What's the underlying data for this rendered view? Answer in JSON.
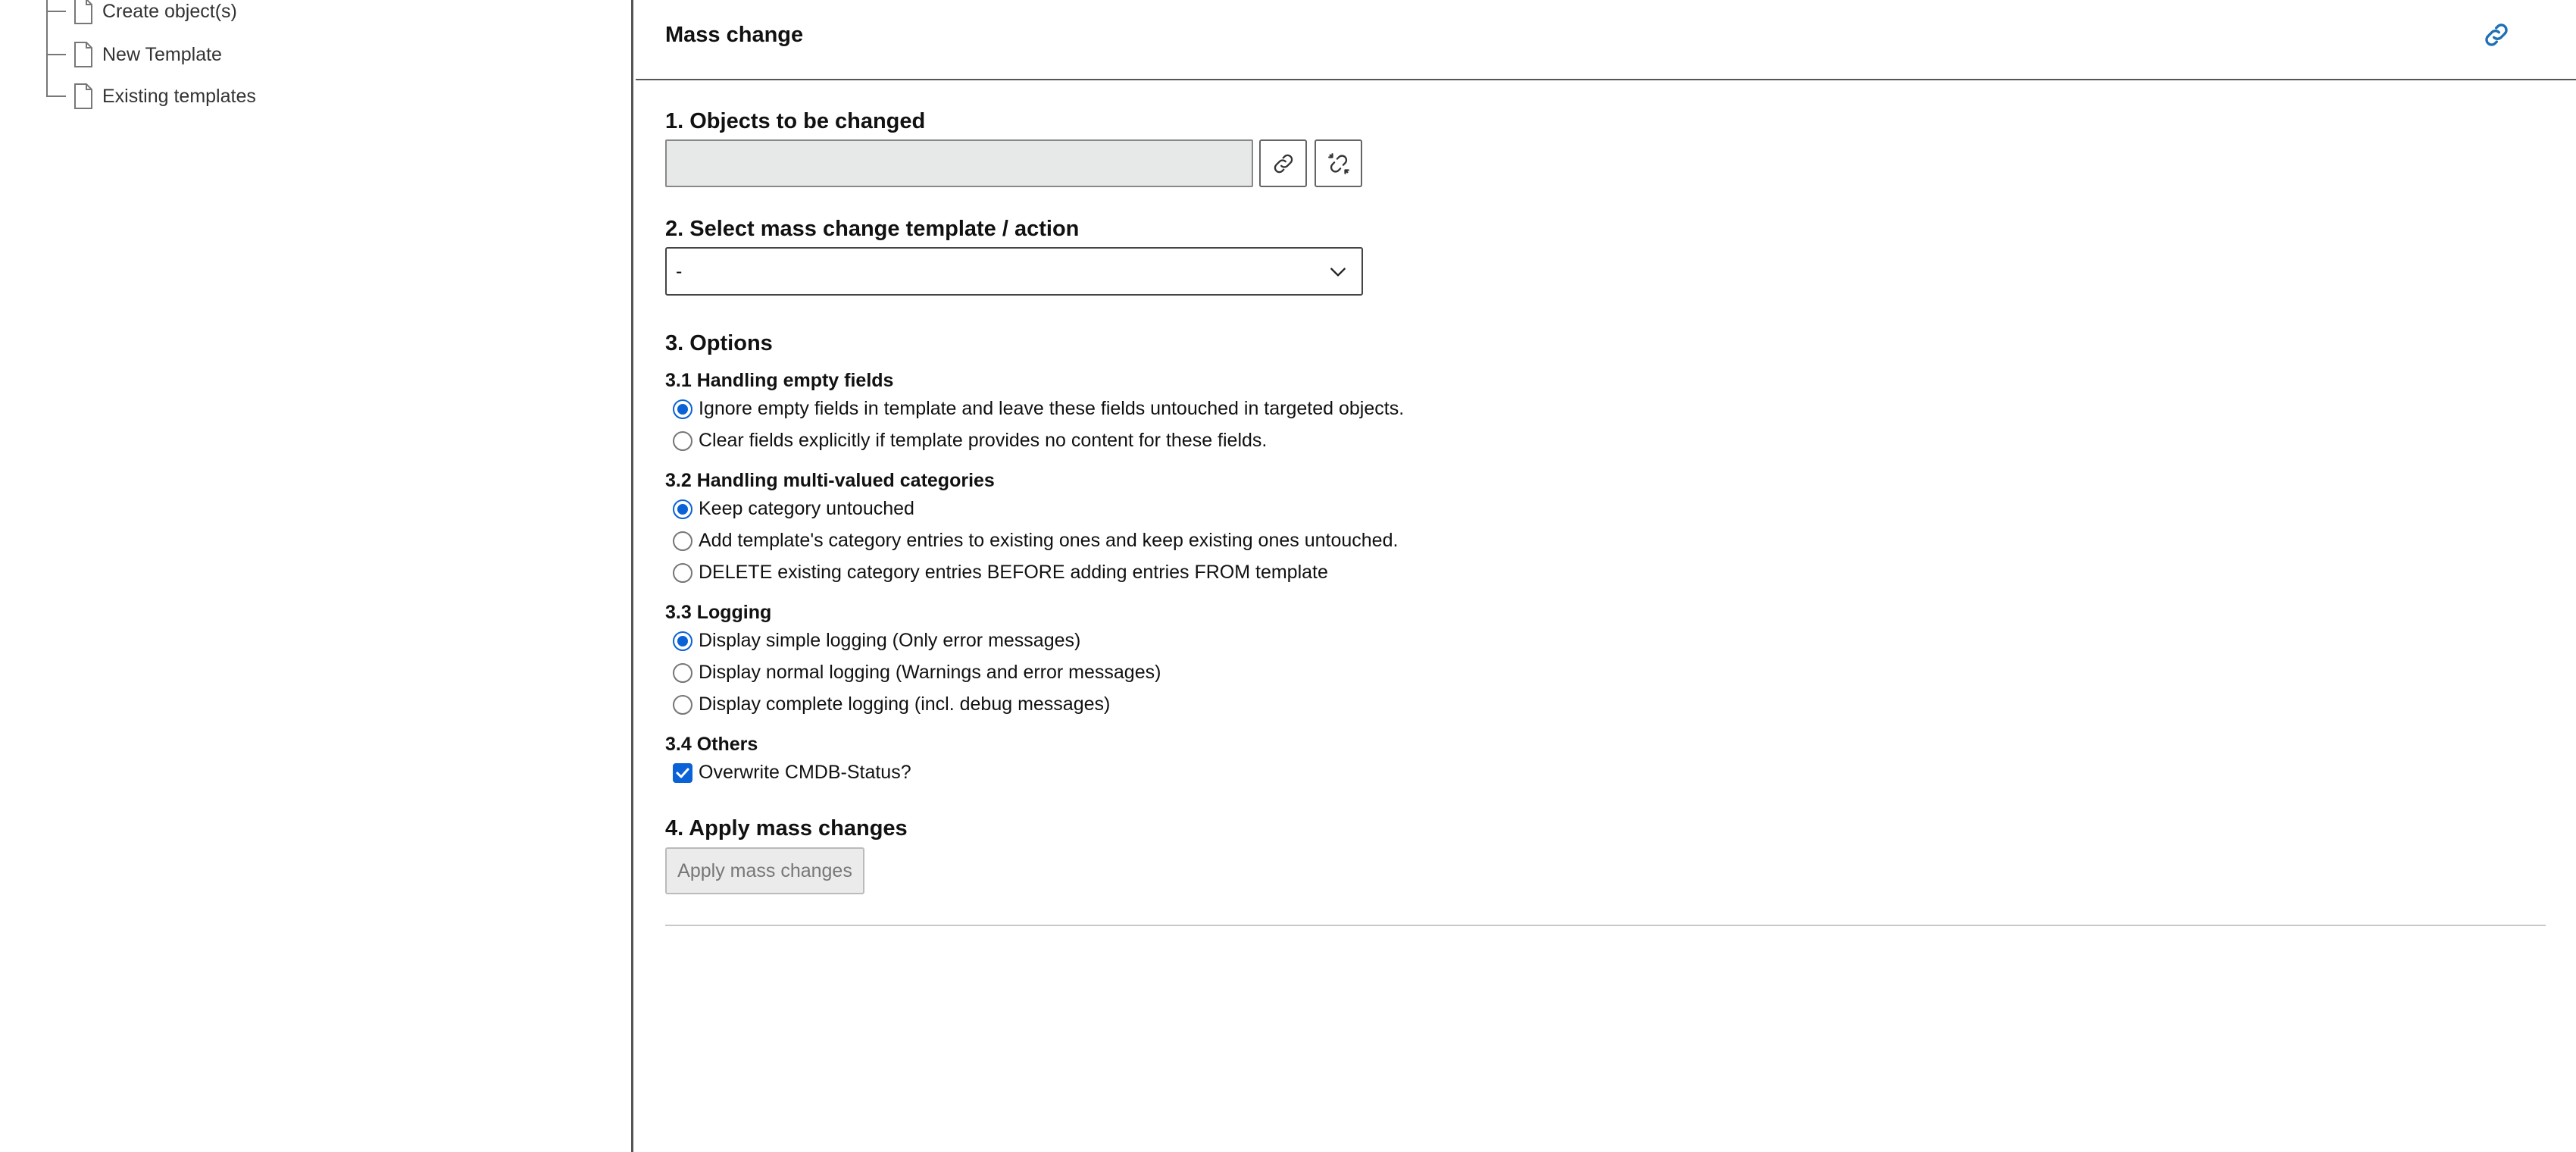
{
  "sidebar": {
    "items": [
      {
        "label": "Create object(s)",
        "icon": "file-icon"
      },
      {
        "label": "New Template",
        "icon": "file-icon"
      },
      {
        "label": "Existing templates",
        "icon": "file-icon"
      }
    ]
  },
  "header": {
    "title": "Mass change",
    "link_icon": "link-icon"
  },
  "section1": {
    "title": "1. Objects to be changed",
    "input_value": "",
    "attach_icon": "link-icon",
    "detach_icon": "unlink-icon"
  },
  "section2": {
    "title": "2. Select mass change template / action",
    "selected": "-"
  },
  "section3": {
    "title": "3. Options",
    "empty_fields": {
      "title": "3.1 Handling empty fields",
      "options": [
        {
          "label": "Ignore empty fields in template and leave these fields untouched in targeted objects.",
          "checked": true
        },
        {
          "label": "Clear fields explicitly if template provides no content for these fields.",
          "checked": false
        }
      ]
    },
    "multivalued": {
      "title": "3.2 Handling multi-valued categories",
      "options": [
        {
          "label": "Keep category untouched",
          "checked": true
        },
        {
          "label": "Add template's category entries to existing ones and keep existing ones untouched.",
          "checked": false
        },
        {
          "label": "DELETE existing category entries BEFORE adding entries FROM template",
          "checked": false
        }
      ]
    },
    "logging": {
      "title": "3.3 Logging",
      "options": [
        {
          "label": "Display simple logging (Only error messages)",
          "checked": true
        },
        {
          "label": "Display normal logging (Warnings and error messages)",
          "checked": false
        },
        {
          "label": "Display complete logging (incl. debug messages)",
          "checked": false
        }
      ]
    },
    "others": {
      "title": "3.4 Others",
      "overwrite_label": "Overwrite CMDB-Status?",
      "overwrite_checked": true
    }
  },
  "section4": {
    "title": "4. Apply mass changes",
    "button_label": "Apply mass changes"
  },
  "colors": {
    "accent": "#0b62d6",
    "link_icon": "#1f6fb5",
    "input_bg": "#e7e9e8"
  }
}
